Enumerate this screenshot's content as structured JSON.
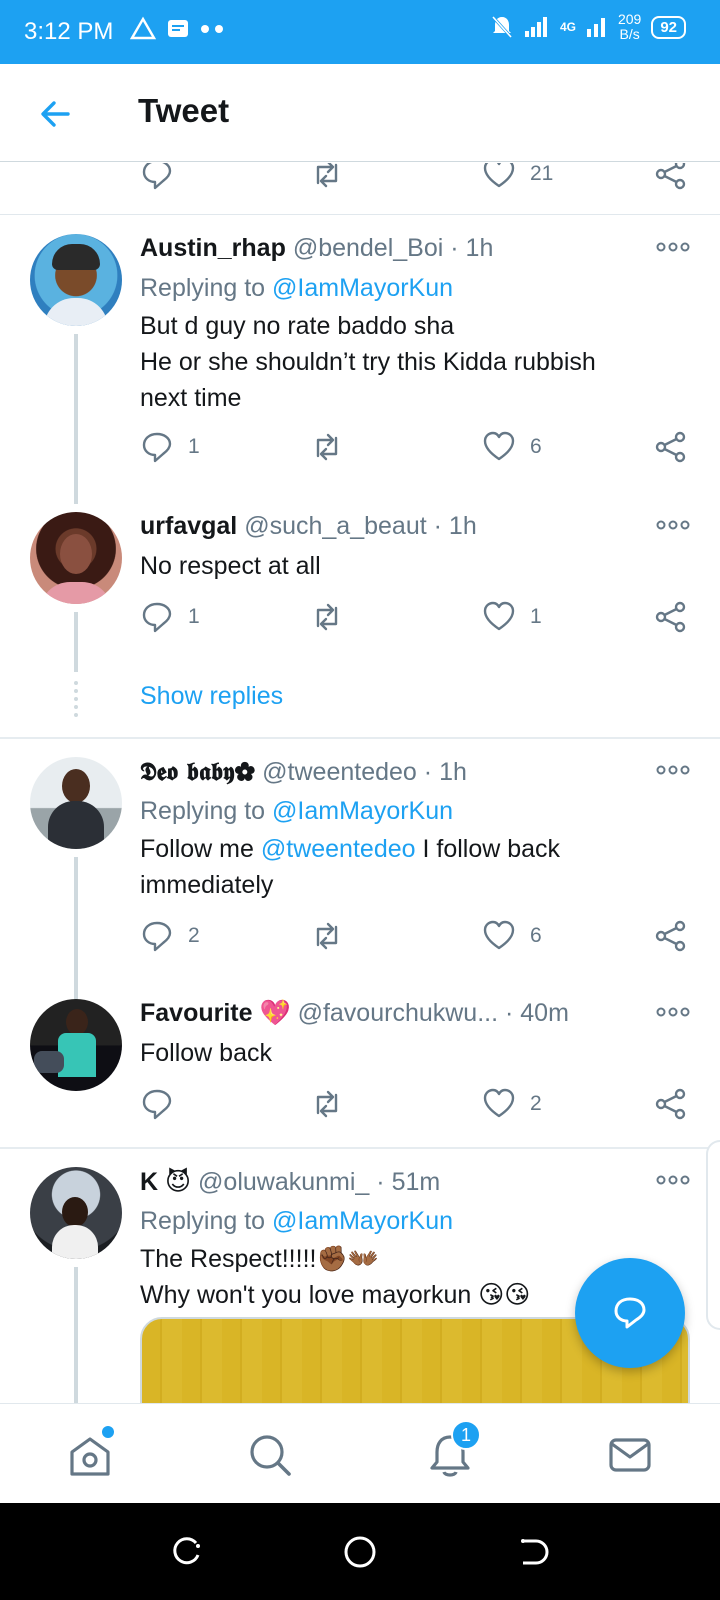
{
  "status_bar": {
    "time": "3:12 PM",
    "network": "4G",
    "speed_value": "209",
    "speed_unit": "B/s",
    "battery": "92"
  },
  "header": {
    "title": "Tweet"
  },
  "top_actions": {
    "like_count": "21"
  },
  "replies": [
    {
      "name": "Austin_rhap",
      "handle": "@bendel_Boi",
      "time": "1h",
      "replying_prefix": "Replying to",
      "replying_to": "@IamMayorKun",
      "text_line1": "But d guy no rate baddo sha",
      "text_line2": "He or she shouldn’t try this Kidda rubbish",
      "text_line3": "next time",
      "reply_count": "1",
      "like_count": "6"
    },
    {
      "name": "urfavgal",
      "handle": "@such_a_beaut",
      "time": "1h",
      "text_line1": "No respect at all",
      "reply_count": "1",
      "like_count": "1"
    },
    {
      "name": "𝕯𝖊𝖔 𝖇𝖆𝖇𝖞✿",
      "handle": "@tweentedeo",
      "time": "1h",
      "replying_prefix": "Replying to",
      "replying_to": "@IamMayorKun",
      "text_prefix": "Follow me",
      "text_mention": "@tweentedeo",
      "text_suffix": "I follow back",
      "text_line2": "immediately",
      "reply_count": "2",
      "like_count": "6"
    },
    {
      "name": "Favourite",
      "name_emoji": "💖",
      "handle": "@favourchukwu...",
      "time": "40m",
      "text_line1": "Follow back",
      "like_count": "2"
    },
    {
      "name": "K",
      "name_emoji": "😈",
      "handle": "@oluwakunmi_",
      "time": "51m",
      "replying_prefix": "Replying to",
      "replying_to": "@IamMayorKun",
      "text_line1": "The Respect!!!!!✊🏾👐🏾",
      "text_line2": "Why won't you love mayorkun 😘😘"
    }
  ],
  "show_replies": "Show replies",
  "bottom_nav": {
    "notifications_badge": "1"
  },
  "colors": {
    "accent": "#1da1f2",
    "text": "#14171a",
    "muted": "#657786",
    "divider": "#e6ecf0"
  }
}
